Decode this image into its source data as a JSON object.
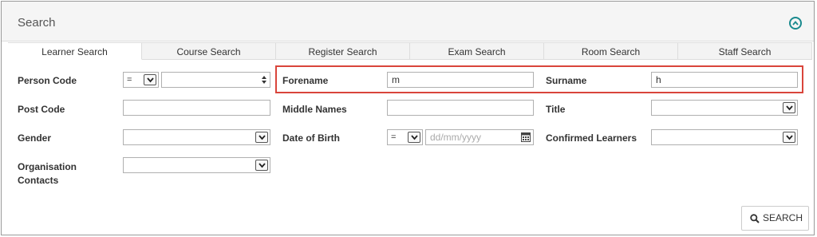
{
  "panel": {
    "title": "Search"
  },
  "tabs": [
    "Learner Search",
    "Course Search",
    "Register Search",
    "Exam Search",
    "Room Search",
    "Staff Search"
  ],
  "fields": {
    "person_code": {
      "label": "Person Code",
      "operator": "=",
      "value": ""
    },
    "forename": {
      "label": "Forename",
      "value": "m"
    },
    "surname": {
      "label": "Surname",
      "value": "h"
    },
    "post_code": {
      "label": "Post Code",
      "value": ""
    },
    "middle_names": {
      "label": "Middle Names",
      "value": ""
    },
    "title": {
      "label": "Title",
      "value": ""
    },
    "gender": {
      "label": "Gender",
      "value": ""
    },
    "date_of_birth": {
      "label": "Date of Birth",
      "operator": "=",
      "placeholder": "dd/mm/yyyy"
    },
    "confirmed_learners": {
      "label": "Confirmed Learners",
      "value": ""
    },
    "organisation_contacts": {
      "label_line1": "Organisation",
      "label_line2": "Contacts",
      "value": ""
    }
  },
  "search_button": {
    "label": "SEARCH"
  },
  "colors": {
    "accent": "#1a8a8e",
    "highlight": "#d9453b"
  }
}
